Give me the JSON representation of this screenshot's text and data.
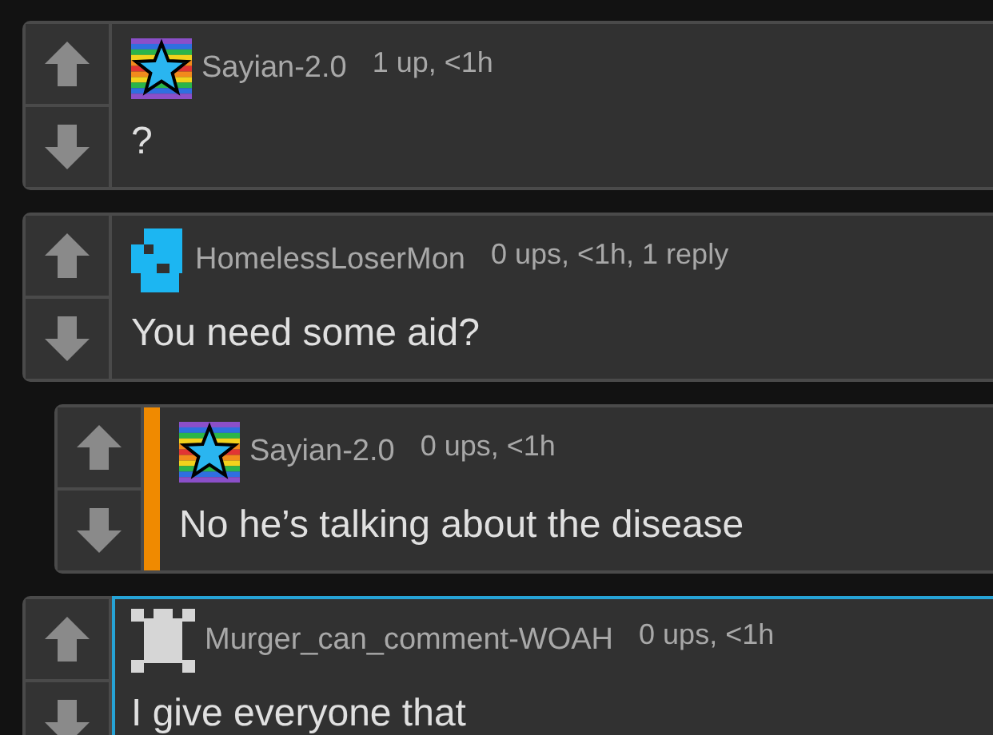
{
  "comments": [
    {
      "username": "Sayian-2.0",
      "avatar": {
        "kind": "rainbow-star"
      },
      "meta": "1 up, <1h",
      "text": "?",
      "highlighted": false
    },
    {
      "username": "HomelessLoserMon",
      "avatar": {
        "kind": "blue-pixel"
      },
      "meta": "0 ups, <1h, 1 reply",
      "text": "You need some aid?",
      "highlighted": false,
      "children": [
        {
          "username": "Sayian-2.0",
          "avatar": {
            "kind": "rainbow-star"
          },
          "meta": "0 ups, <1h",
          "text": "No he’s talking about the disease",
          "highlighted": false
        }
      ]
    },
    {
      "username": "Murger_can_comment-WOAH",
      "avatar": {
        "kind": "white-pixel"
      },
      "meta": "0 ups, <1h",
      "text": "I give everyone that",
      "highlighted": true
    }
  ]
}
